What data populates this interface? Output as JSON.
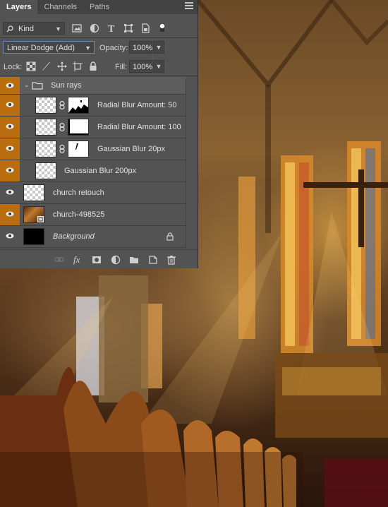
{
  "panel": {
    "tabs": [
      {
        "label": "Layers",
        "active": true
      },
      {
        "label": "Channels",
        "active": false
      },
      {
        "label": "Paths",
        "active": false
      }
    ],
    "filter": {
      "label": "Kind",
      "icons": [
        "image-filter-icon",
        "adjustment-filter-icon",
        "type-filter-icon",
        "shape-filter-icon",
        "smart-object-filter-icon",
        "filter-toggle-icon"
      ]
    },
    "blend_mode": "Linear Dodge (Add)",
    "opacity_label": "Opacity:",
    "opacity_value": "100%",
    "lock_label": "Lock:",
    "fill_label": "Fill:",
    "fill_value": "100%",
    "highlight_color": "#b96d0e"
  },
  "layers": [
    {
      "name": "Sun rays",
      "type": "group",
      "visible": true,
      "highlighted": true
    },
    {
      "name": "Radial Blur Amount: 50",
      "type": "layer-with-mask",
      "visible": true,
      "highlighted": true
    },
    {
      "name": "Radial Blur Amount: 100",
      "type": "layer-with-mask",
      "visible": true,
      "highlighted": true
    },
    {
      "name": "Gaussian Blur 20px",
      "type": "layer-with-mask",
      "visible": true,
      "highlighted": true
    },
    {
      "name": "Gaussian Blur 200px",
      "type": "layer",
      "visible": true,
      "highlighted": true
    },
    {
      "name": "church retouch",
      "type": "layer",
      "visible": true,
      "highlighted": false
    },
    {
      "name": "church-498525",
      "type": "smart-object",
      "visible": true,
      "highlighted": true
    },
    {
      "name": "Background",
      "type": "background",
      "visible": true,
      "highlighted": false,
      "locked": true
    }
  ],
  "bottom_icons": [
    "link-layers-icon",
    "fx-icon",
    "add-mask-icon",
    "adjustment-layer-icon",
    "new-group-icon",
    "new-layer-icon",
    "delete-layer-icon"
  ]
}
